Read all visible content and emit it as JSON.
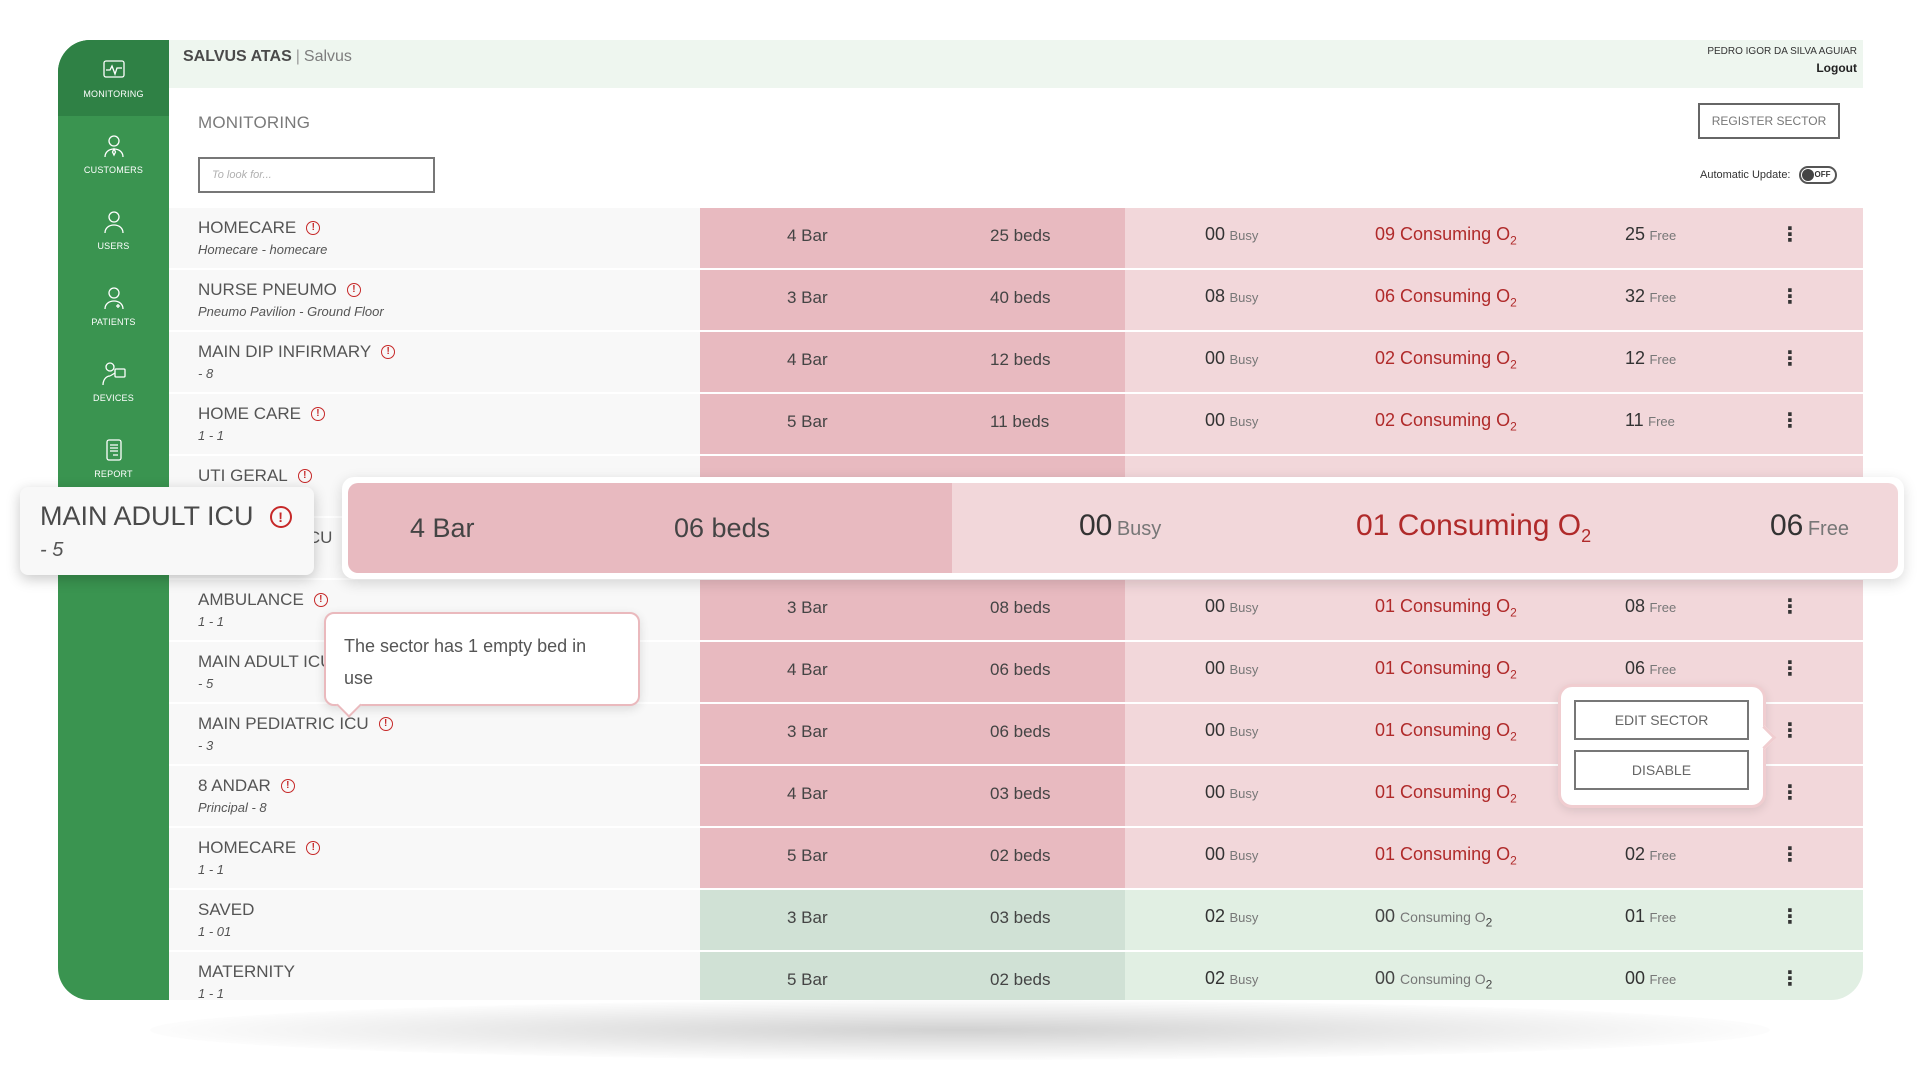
{
  "header": {
    "brand": "SALVUS ATAS",
    "separator": "|",
    "brand_sub": "Salvus",
    "user_name": "PEDRO IGOR DA SILVA AGUIAR",
    "logout_label": "Logout"
  },
  "sidebar": {
    "items": [
      {
        "label": "MONITORING",
        "icon": "monitor-pulse-icon",
        "active": true
      },
      {
        "label": "CUSTOMERS",
        "icon": "customer-tie-icon"
      },
      {
        "label": "USERS",
        "icon": "user-icon"
      },
      {
        "label": "PATIENTS",
        "icon": "patient-icon"
      },
      {
        "label": "DEVICES",
        "icon": "device-user-icon"
      },
      {
        "label": "REPORT",
        "icon": "report-document-icon"
      }
    ]
  },
  "main": {
    "title": "MONITORING",
    "register_button": "REGISTER SECTOR",
    "search_placeholder": "To look for...",
    "auto_update_label": "Automatic Update:",
    "auto_update_state": "OFF"
  },
  "labels": {
    "bar_suffix": "Bar",
    "beds_suffix": "beds",
    "busy": "Busy",
    "consuming": "Consuming O",
    "o2_sub": "2",
    "free": "Free",
    "menu_dots": "⋮",
    "alert": "!"
  },
  "rows": [
    {
      "name": "HOMECARE",
      "sub": "Homecare - homecare",
      "alert": true,
      "status": "red",
      "bar": "4 Bar",
      "beds": "25 beds",
      "busy": "00",
      "consuming": "09",
      "free": "25"
    },
    {
      "name": "NURSE PNEUMO",
      "sub": "Pneumo Pavilion - Ground Floor",
      "alert": true,
      "status": "red",
      "bar": "3 Bar",
      "beds": "40 beds",
      "busy": "08",
      "consuming": "06",
      "free": "32"
    },
    {
      "name": "MAIN DIP INFIRMARY",
      "sub": "- 8",
      "alert": true,
      "status": "red",
      "bar": "4 Bar",
      "beds": "12 beds",
      "busy": "00",
      "consuming": "02",
      "free": "12"
    },
    {
      "name": "HOME CARE",
      "sub": "1 - 1",
      "alert": true,
      "status": "red",
      "bar": "5 Bar",
      "beds": "11 beds",
      "busy": "00",
      "consuming": "02",
      "free": "11"
    },
    {
      "name": "UTI GERAL",
      "sub": "",
      "alert": true,
      "status": "red",
      "bar": "",
      "beds": "",
      "busy": "",
      "consuming": "",
      "free": ""
    },
    {
      "name": "MAIN ADULT ICU",
      "sub": "- 5",
      "alert": true,
      "status": "red",
      "bar": "4 Bar",
      "beds": "06 beds",
      "busy": "00",
      "consuming": "01",
      "free": "06"
    },
    {
      "name": "AMBULANCE",
      "sub": "1 - 1",
      "alert": true,
      "status": "red",
      "bar": "3 Bar",
      "beds": "08 beds",
      "busy": "00",
      "consuming": "01",
      "free": "08"
    },
    {
      "name": "MAIN ADULT ICU",
      "sub": "- 5",
      "alert": false,
      "status": "red",
      "bar": "4 Bar",
      "beds": "06 beds",
      "busy": "00",
      "consuming": "01",
      "free": "06"
    },
    {
      "name": "MAIN PEDIATRIC ICU",
      "sub": "- 3",
      "alert": true,
      "status": "red",
      "bar": "3 Bar",
      "beds": "06 beds",
      "busy": "00",
      "consuming": "01",
      "free": ""
    },
    {
      "name": "8 ANDAR",
      "sub": "Principal - 8",
      "alert": true,
      "status": "red",
      "bar": "4 Bar",
      "beds": "03 beds",
      "busy": "00",
      "consuming": "01",
      "free": ""
    },
    {
      "name": "HOMECARE",
      "sub": "1 - 1",
      "alert": true,
      "status": "red",
      "bar": "5 Bar",
      "beds": "02 beds",
      "busy": "00",
      "consuming": "01",
      "free": "02"
    },
    {
      "name": "SAVED",
      "sub": "1 - 01",
      "alert": false,
      "status": "green",
      "bar": "3 Bar",
      "beds": "03 beds",
      "busy": "02",
      "consuming": "00",
      "free": "01"
    },
    {
      "name": "MATERNITY",
      "sub": "1 - 1",
      "alert": false,
      "status": "green",
      "bar": "5 Bar",
      "beds": "02 beds",
      "busy": "02",
      "consuming": "00",
      "free": "00"
    }
  ],
  "highlight": {
    "name": "MAIN ADULT ICU",
    "sub": "- 5",
    "bar": "4 Bar",
    "beds": "06 beds",
    "busy": "00",
    "consuming": "01",
    "free": "06"
  },
  "tooltip": {
    "text": "The sector has 1 empty bed in use"
  },
  "context_menu": {
    "edit_label": "EDIT SECTOR",
    "disable_label": "DISABLE"
  },
  "colors": {
    "sidebar": "#3a9450",
    "sidebar_active": "#2f8145",
    "alert_red": "#c62828",
    "row_red_dark": "#e8bac0",
    "row_red_light": "#f2d7da",
    "row_green_dark": "#d0e1d5",
    "row_green_light": "#e1efe3"
  }
}
